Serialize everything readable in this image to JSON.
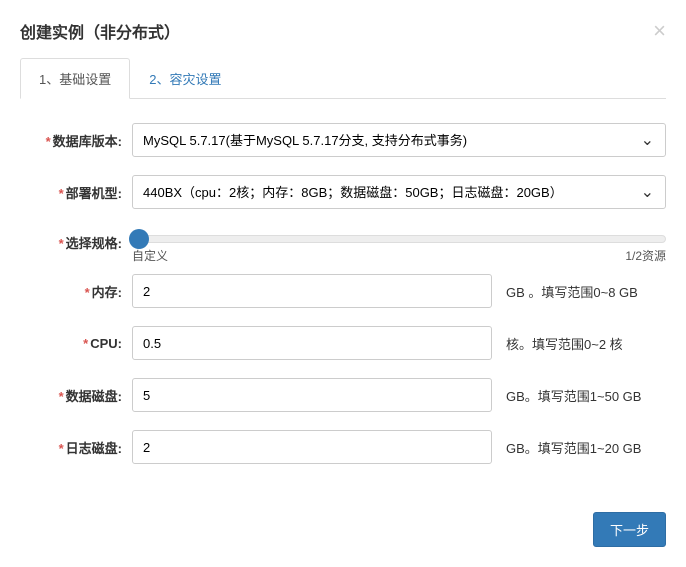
{
  "header": {
    "title": "创建实例（非分布式）",
    "close": "×"
  },
  "tabs": [
    {
      "label": "1、基础设置",
      "active": true
    },
    {
      "label": "2、容灾设置",
      "active": false
    }
  ],
  "fields": {
    "db_version": {
      "label": "数据库版本:",
      "value": "MySQL 5.7.17(基于MySQL 5.7.17分支, 支持分布式事务)"
    },
    "machine_type": {
      "label": "部署机型:",
      "value": "440BX（cpu：2核；内存：8GB；数据磁盘：50GB；日志磁盘：20GB）"
    },
    "spec": {
      "label": "选择规格:",
      "left": "自定义",
      "right": "1/2资源"
    },
    "memory": {
      "label": "内存:",
      "value": "2",
      "hint": "GB 。填写范围0~8 GB"
    },
    "cpu": {
      "label": "CPU:",
      "value": "0.5",
      "hint": "核。填写范围0~2 核"
    },
    "data_disk": {
      "label": "数据磁盘:",
      "value": "5",
      "hint": "GB。填写范围1~50 GB"
    },
    "log_disk": {
      "label": "日志磁盘:",
      "value": "2",
      "hint": "GB。填写范围1~20 GB"
    }
  },
  "footer": {
    "next": "下一步"
  }
}
